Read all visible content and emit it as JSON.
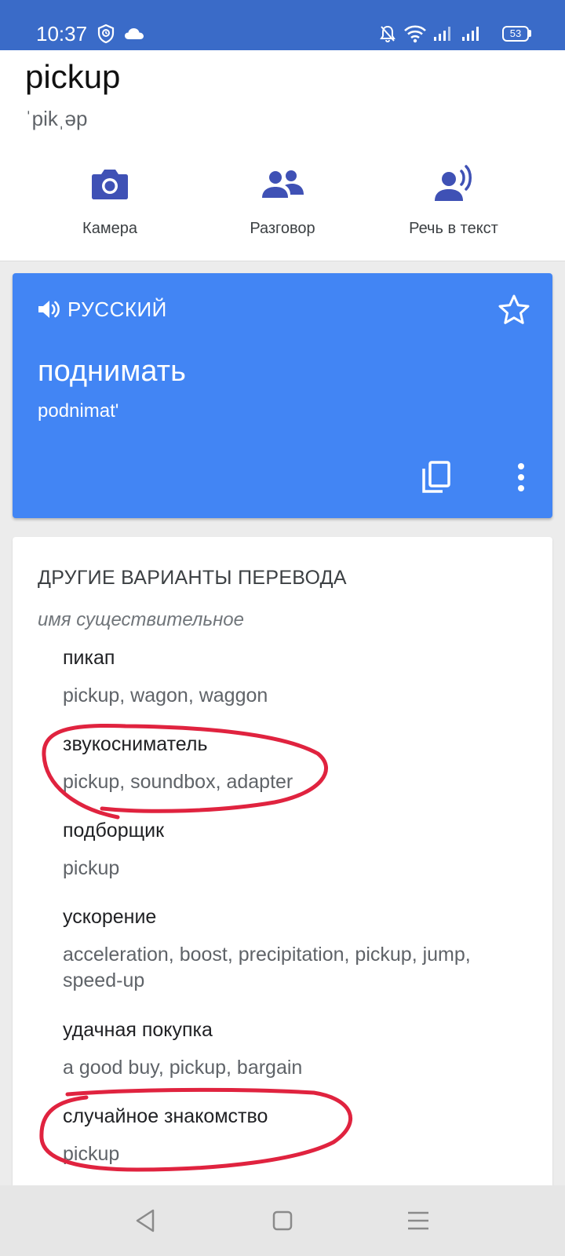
{
  "status_bar": {
    "time": "10:37",
    "battery": "53",
    "icons": [
      "shield-icon",
      "cloud-icon",
      "bell-off-icon",
      "wifi-icon",
      "signal-icon",
      "signal-icon",
      "battery-icon"
    ]
  },
  "entry": {
    "word": "pickup",
    "transcription": "ˈpikˌəp"
  },
  "tools": [
    {
      "label": "Камера",
      "icon": "camera-icon"
    },
    {
      "label": "Разговор",
      "icon": "people-icon"
    },
    {
      "label": "Речь в текст",
      "icon": "voice-icon"
    }
  ],
  "translation": {
    "language": "РУССКИЙ",
    "text": "поднимать",
    "transliteration": "podnimat'",
    "icons": [
      "speaker-icon",
      "star-icon",
      "copy-icon",
      "more-vert-icon"
    ]
  },
  "variants": {
    "title": "ДРУГИЕ ВАРИАНТЫ ПЕРЕВОДА",
    "part_of_speech": "имя существительное",
    "items": [
      {
        "word": "пикап",
        "synonyms": "pickup, wagon, waggon"
      },
      {
        "word": "звукосниматель",
        "synonyms": "pickup, soundbox, adapter"
      },
      {
        "word": "подборщик",
        "synonyms": "pickup"
      },
      {
        "word": "ускорение",
        "synonyms": "acceleration, boost, precipitation, pickup, jump, speed-up"
      },
      {
        "word": "удачная покупка",
        "synonyms": "a good buy, pickup, bargain"
      },
      {
        "word": "случайное знакомство",
        "synonyms": "pickup"
      }
    ]
  },
  "colors": {
    "status_bar": "#3a6bc8",
    "card_accent": "#4285f4",
    "icon_indigo": "#3f51b5",
    "annotation_red": "#e0233f"
  },
  "nav": {
    "icons": [
      "back-icon",
      "home-icon",
      "menu-icon"
    ]
  }
}
